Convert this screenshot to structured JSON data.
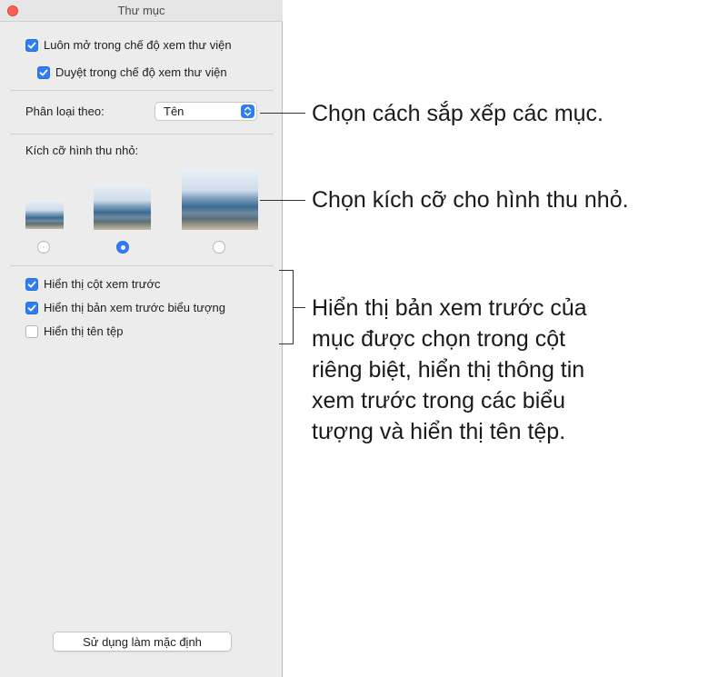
{
  "window": {
    "title": "Thư mục"
  },
  "library": {
    "always_open": {
      "label": "Luôn mở trong chế độ xem thư viện",
      "checked": true
    },
    "browse": {
      "label": "Duyệt trong chế độ xem thư viện",
      "checked": true
    }
  },
  "sort": {
    "label": "Phân loại theo:",
    "selected": "Tên"
  },
  "thumbnails": {
    "label": "Kích cỡ hình thu nhỏ:",
    "selected_index": 1
  },
  "preview": {
    "show_column": {
      "label": "Hiển thị cột xem trước",
      "checked": true
    },
    "show_icon_preview": {
      "label": "Hiển thị bản xem trước biểu tượng",
      "checked": true
    },
    "show_filename": {
      "label": "Hiển thị tên tệp",
      "checked": false
    }
  },
  "footer": {
    "default_button": "Sử dụng làm mặc định"
  },
  "callouts": {
    "sort": "Chọn cách sắp xếp các mục.",
    "thumb_size": "Chọn kích cỡ cho hình thu nhỏ.",
    "preview_lines": [
      "Hiển thị bản xem trước của",
      "mục được chọn trong cột",
      "riêng biệt, hiển thị thông tin",
      "xem trước trong các biểu",
      "tượng và hiển thị tên tệp."
    ]
  },
  "colors": {
    "accent": "#2f7df6",
    "close": "#fe5f57"
  }
}
